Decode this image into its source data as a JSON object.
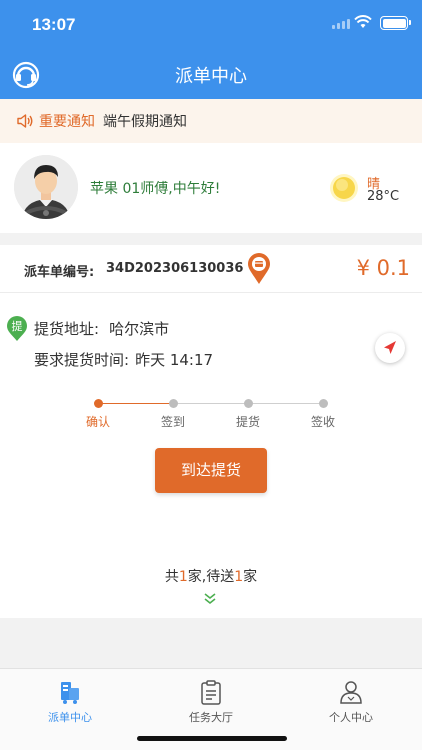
{
  "status_bar": {
    "time": "13:07"
  },
  "header": {
    "title": "派单中心",
    "service_icon": "customer-service-icon"
  },
  "notice": {
    "tag": "重要通知",
    "text": "端午假期通知"
  },
  "greeting": {
    "message": "苹果 01师傅,中午好!",
    "weather_desc": "晴",
    "temperature": "28°C"
  },
  "order": {
    "label": "派车单编号:",
    "number": "34D202306130036",
    "price": "¥ 0.1",
    "pickup_badge": "提",
    "address_label": "提货地址:",
    "address_value": "哈尔滨市",
    "time_label": "要求提货时间:",
    "time_value": "昨天 14:17",
    "steps": [
      "确认",
      "签到",
      "提货",
      "签收"
    ],
    "active_step": 0,
    "action_button": "到达提货"
  },
  "summary": {
    "prefix": "共",
    "total": "1",
    "middle": "家,待送",
    "pending": "1",
    "suffix": "家"
  },
  "tabs": [
    {
      "label": "派单中心",
      "icon": "dispatch-icon",
      "active": true
    },
    {
      "label": "任务大厅",
      "icon": "clipboard-icon",
      "active": false
    },
    {
      "label": "个人中心",
      "icon": "person-icon",
      "active": false
    }
  ],
  "colors": {
    "primary": "#3d91ec",
    "accent": "#e06a2a",
    "green": "#2e7d3a"
  }
}
